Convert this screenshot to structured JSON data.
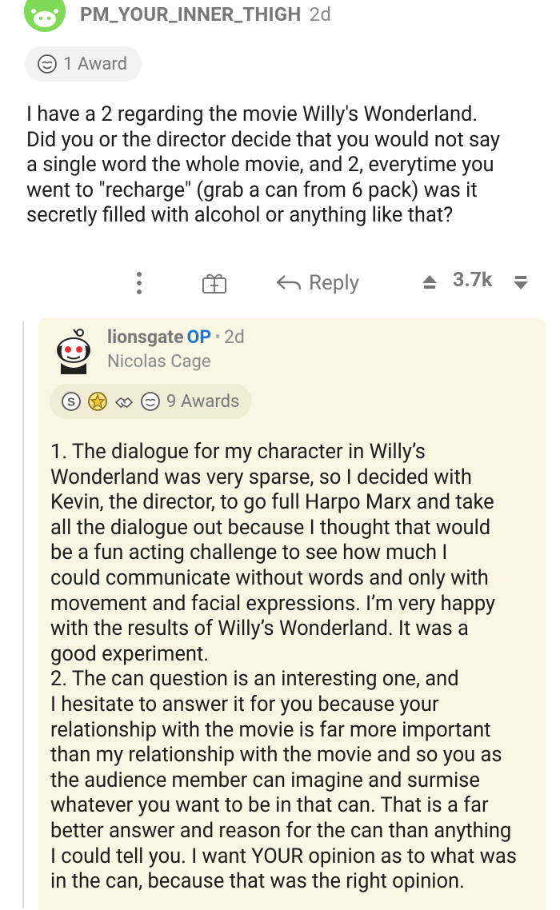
{
  "comment": {
    "username": "PM_YOUR_INNER_THIGH",
    "time": "2d",
    "awards_label": "1 Award",
    "body_lines": [
      "I have a 2 regarding the movie Willy's Wonderland.",
      "Did you or the director decide that you would not say",
      "a single word the whole movie, and 2, everytime you",
      "went to \"recharge\" (grab a can from 6 pack) was it",
      "secretly filled with alcohol or anything like that?"
    ],
    "actions": {
      "reply_label": "Reply",
      "score": "3.7k"
    }
  },
  "reply": {
    "username": "lionsgate",
    "op_tag": "OP",
    "separator": "•",
    "time": "2d",
    "flair": "Nicolas Cage",
    "awards_label": "9 Awards",
    "body_lines": [
      "1. The dialogue for my character in Willy’s",
      "Wonderland was very sparse, so I decided with",
      "Kevin, the director, to go full Harpo Marx and take",
      "all the dialogue out because I thought that would",
      "be a fun acting challenge to see how much I",
      "could communicate without words and only with",
      "movement and facial expressions. I’m very happy",
      "with the results of Willy’s Wonderland. It was a",
      "good experiment.",
      "2. The can question is an interesting one, and",
      "I hesitate to answer it for you because your",
      "relationship with the movie is far more important",
      "than my relationship with the movie and so you as",
      "the audience member can imagine and surmise",
      "whatever you want to be in that can. That is a far",
      "better answer and reason for the can than anything",
      "I could tell you. I want YOUR opinion as to what was",
      "in the can, because that was the right opinion."
    ]
  },
  "colors": {
    "reply_background": "#faf6e3",
    "op_blue": "#1b79cf",
    "avatar_green": "#7ed957"
  },
  "icons": {
    "more": "vertical-ellipsis-icon",
    "gift": "gift-icon",
    "reply": "reply-arrow-icon",
    "upvote": "upvote-arrow-icon",
    "downvote": "downvote-arrow-icon",
    "award_wholesome": "wholesome-award-icon"
  }
}
